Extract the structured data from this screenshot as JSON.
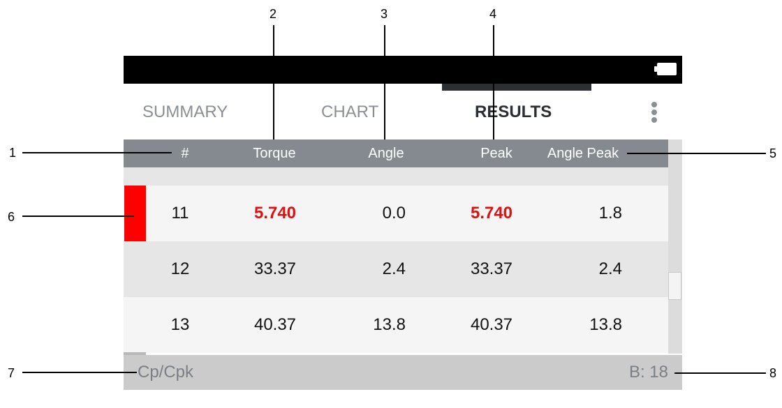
{
  "tabs": [
    {
      "label": "SUMMARY",
      "active": false
    },
    {
      "label": "CHART",
      "active": false
    },
    {
      "label": "RESULTS",
      "active": true
    }
  ],
  "icons": {
    "battery": "battery-icon",
    "menu": "more-vert-icon"
  },
  "table": {
    "columns": [
      "#",
      "Torque",
      "Angle",
      "Peak",
      "Angle Peak"
    ],
    "rows": [
      {
        "num": "11",
        "torque": "5.740",
        "angle": "0.0",
        "peak": "5.740",
        "angle_peak": "1.8",
        "status": "nok"
      },
      {
        "num": "12",
        "torque": "33.37",
        "angle": "2.4",
        "peak": "33.37",
        "angle_peak": "2.4",
        "status": "ok"
      },
      {
        "num": "13",
        "torque": "40.37",
        "angle": "13.8",
        "peak": "40.37",
        "angle_peak": "13.8",
        "status": "ok"
      }
    ]
  },
  "footer": {
    "left": "Cp/Cpk",
    "right": "B: 18"
  },
  "callouts": [
    "1",
    "2",
    "3",
    "4",
    "5",
    "6",
    "7",
    "8"
  ],
  "colors": {
    "alert": "#e01010",
    "header_bg": "#858a90",
    "status_bar": "#000000"
  }
}
